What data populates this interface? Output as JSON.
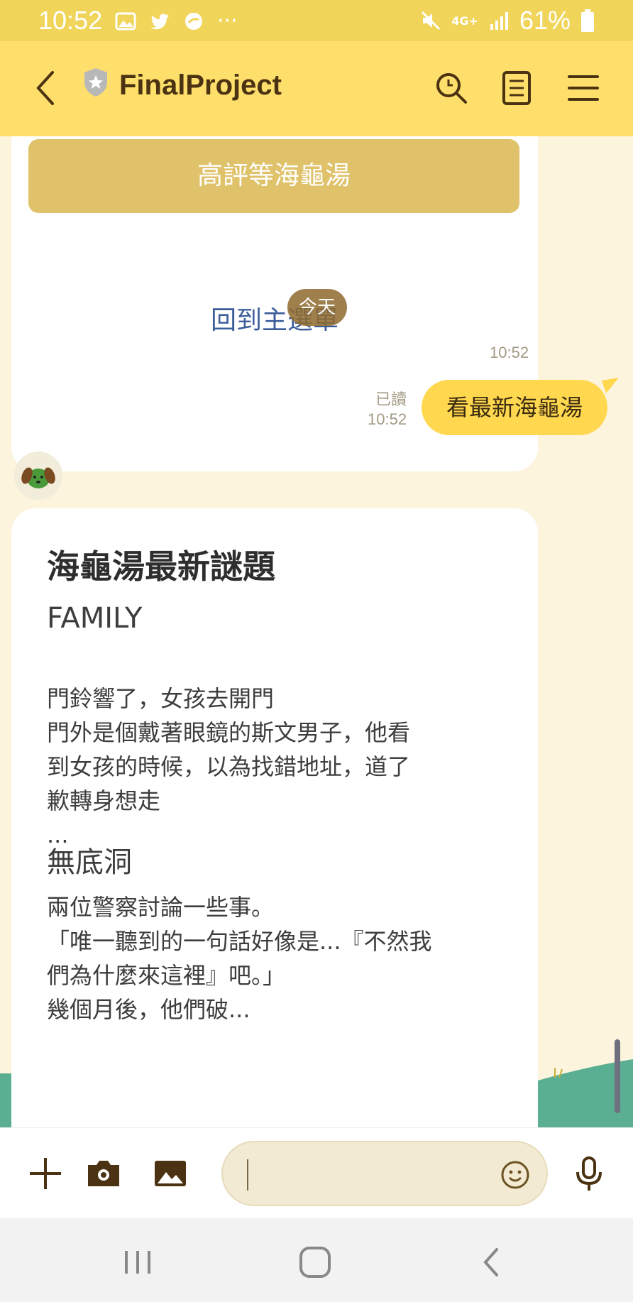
{
  "status_bar": {
    "time": "10:52",
    "battery": "61%",
    "network": "4G+"
  },
  "header": {
    "title": "FinalProject"
  },
  "messages": {
    "top_card": {
      "button_text": "高評等海龜湯",
      "link_text": "回到主選單"
    },
    "date_pill": "今天",
    "bot_time": "10:52",
    "user_read": "已讀",
    "user_time": "10:52",
    "user_text": "看最新海龜湯",
    "puzzle_card": {
      "heading": "海龜湯最新謎題",
      "items": [
        {
          "title": "FAMILY",
          "desc": "門鈴響了，女孩去開門\n門外是個戴著眼鏡的斯文男子，他看\n到女孩的時候，以為找錯地址，道了\n歉轉身想走\n..."
        },
        {
          "title": "無底洞",
          "desc": "兩位警察討論一些事。\n「唯一聽到的一句話好像是...『不然我\n們為什麼來這裡』吧。」\n幾個月後，他們破..."
        }
      ]
    }
  },
  "input": {
    "placeholder": ""
  },
  "colors": {
    "header_bg": "#ffdf6b",
    "status_bg": "#f0d55a",
    "user_bubble": "#ffd84f",
    "link": "#3b5d9a",
    "chat_bg": "#fcf4dc"
  }
}
